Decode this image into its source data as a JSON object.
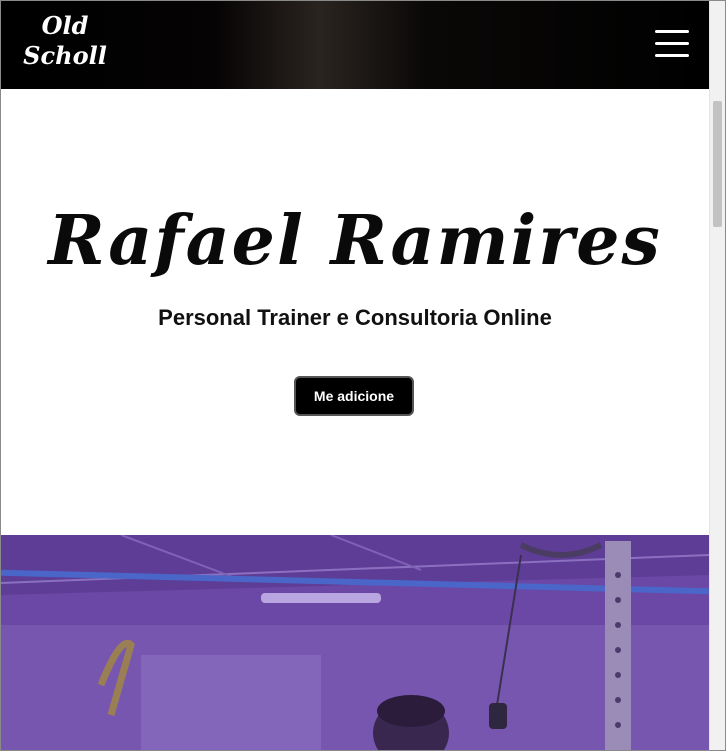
{
  "header": {
    "logo_line1": "Old",
    "logo_line2": "Scholl",
    "menu_icon": "hamburger-menu-icon"
  },
  "hero": {
    "name": "Rafael Ramires",
    "subtitle": "Personal Trainer e Consultoria Online",
    "cta_label": "Me adicione"
  },
  "photo": {
    "overlay_color": "#6a47a3"
  },
  "colors": {
    "header_bg": "#000000",
    "button_bg": "#000000",
    "button_text": "#ffffff",
    "photo_overlay": "#6a47a3"
  }
}
